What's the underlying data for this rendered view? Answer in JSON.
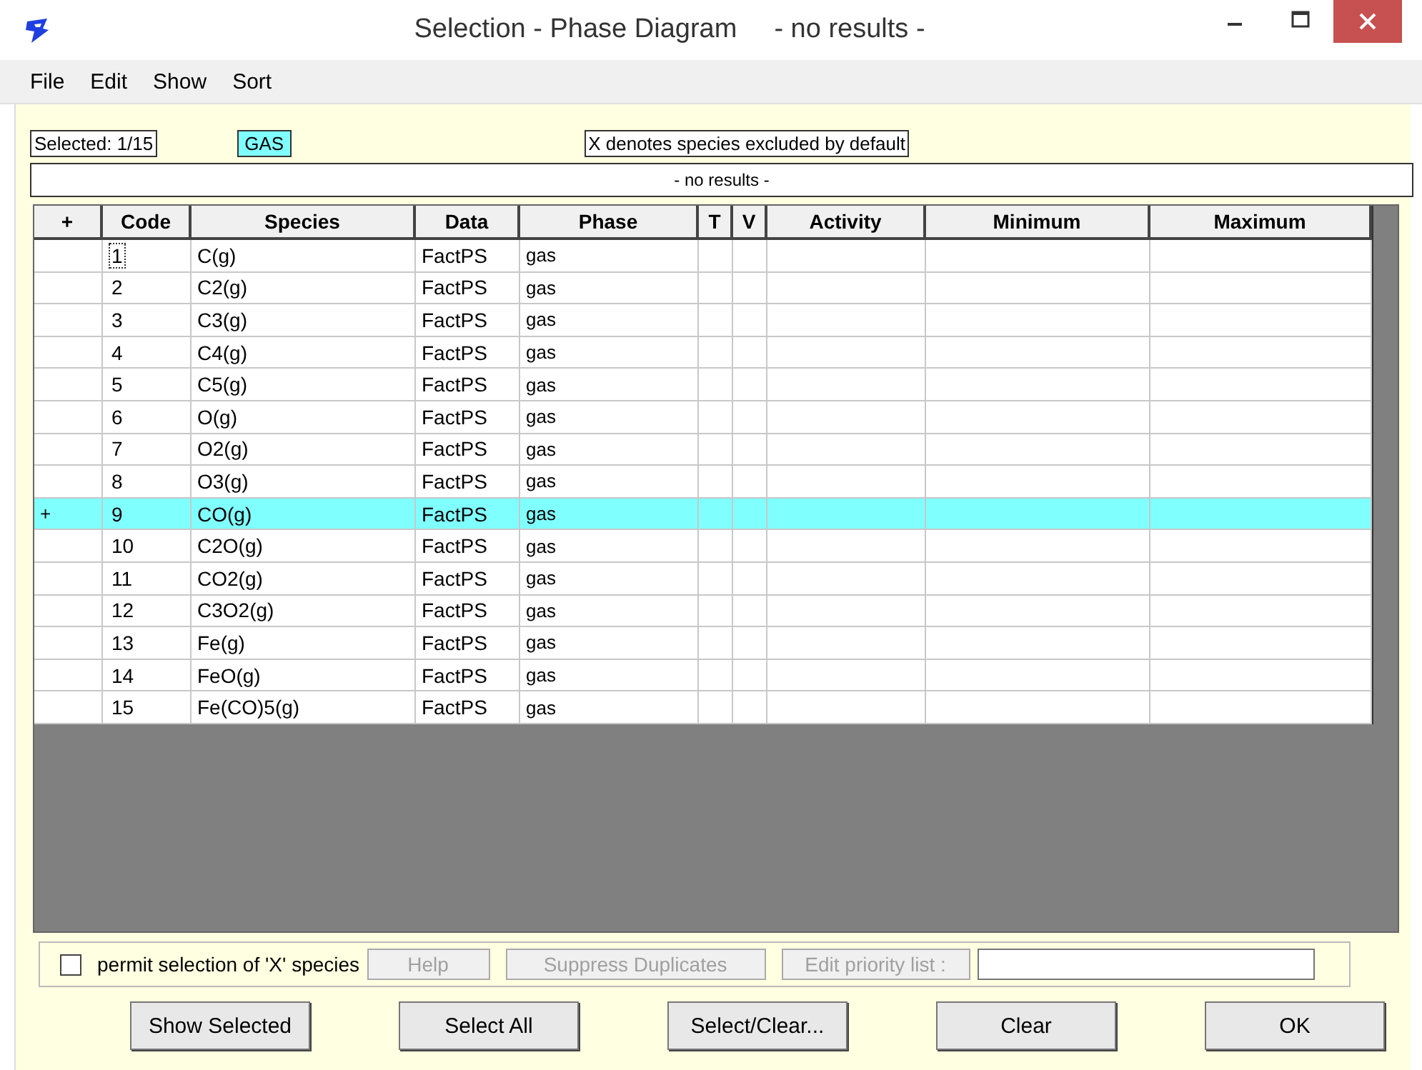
{
  "window": {
    "title": "Selection - Phase Diagram",
    "subtitle": "- no results -"
  },
  "menu": [
    "File",
    "Edit",
    "Show",
    "Sort"
  ],
  "info": {
    "selected": "Selected: 1/15",
    "phase_tag": "GAS",
    "note": "X denotes species excluded by default",
    "status": "- no results -"
  },
  "table": {
    "columns": [
      "+",
      "Code",
      "Species",
      "Data",
      "Phase",
      "T",
      "V",
      "Activity",
      "Minimum",
      "Maximum"
    ],
    "rows": [
      {
        "code": "1",
        "species": "C(g)",
        "data": "FactPS",
        "phase": "gas",
        "selected": false,
        "focused": true
      },
      {
        "code": "2",
        "species": "C2(g)",
        "data": "FactPS",
        "phase": "gas",
        "selected": false,
        "focused": false
      },
      {
        "code": "3",
        "species": "C3(g)",
        "data": "FactPS",
        "phase": "gas",
        "selected": false,
        "focused": false
      },
      {
        "code": "4",
        "species": "C4(g)",
        "data": "FactPS",
        "phase": "gas",
        "selected": false,
        "focused": false
      },
      {
        "code": "5",
        "species": "C5(g)",
        "data": "FactPS",
        "phase": "gas",
        "selected": false,
        "focused": false
      },
      {
        "code": "6",
        "species": "O(g)",
        "data": "FactPS",
        "phase": "gas",
        "selected": false,
        "focused": false
      },
      {
        "code": "7",
        "species": "O2(g)",
        "data": "FactPS",
        "phase": "gas",
        "selected": false,
        "focused": false
      },
      {
        "code": "8",
        "species": "O3(g)",
        "data": "FactPS",
        "phase": "gas",
        "selected": false,
        "focused": false
      },
      {
        "plus": "+",
        "code": "9",
        "species": "CO(g)",
        "data": "FactPS",
        "phase": "gas",
        "selected": true,
        "focused": false
      },
      {
        "code": "10",
        "species": "C2O(g)",
        "data": "FactPS",
        "phase": "gas",
        "selected": false,
        "focused": false
      },
      {
        "code": "11",
        "species": "CO2(g)",
        "data": "FactPS",
        "phase": "gas",
        "selected": false,
        "focused": false
      },
      {
        "code": "12",
        "species": "C3O2(g)",
        "data": "FactPS",
        "phase": "gas",
        "selected": false,
        "focused": false
      },
      {
        "code": "13",
        "species": "Fe(g)",
        "data": "FactPS",
        "phase": "gas",
        "selected": false,
        "focused": false
      },
      {
        "code": "14",
        "species": "FeO(g)",
        "data": "FactPS",
        "phase": "gas",
        "selected": false,
        "focused": false
      },
      {
        "code": "15",
        "species": "Fe(CO)5(g)",
        "data": "FactPS",
        "phase": "gas",
        "selected": false,
        "focused": false
      }
    ]
  },
  "options": {
    "checkbox": {
      "label": "permit selection of 'X' species",
      "checked": false
    },
    "buttons": [
      {
        "label": "Help",
        "disabled": true
      },
      {
        "label": "Suppress Duplicates",
        "disabled": true
      },
      {
        "label": "Edit priority list :",
        "disabled": true
      }
    ]
  },
  "buttons": [
    "Show Selected",
    "Select All",
    "Select/Clear...",
    "Clear",
    "OK"
  ]
}
